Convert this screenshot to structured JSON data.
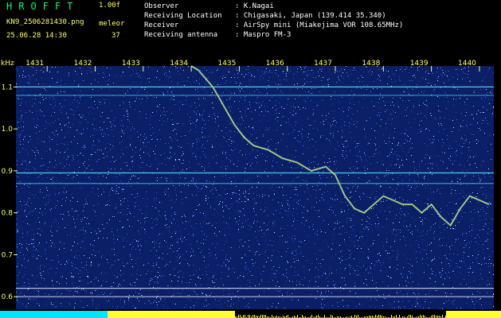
{
  "header": {
    "title": "HROFFT",
    "version": "1.00f",
    "filename": "KN9_2506281430.png",
    "label_right": "meleor",
    "datetime": "25.06.28 14:30",
    "count": "37",
    "info": [
      {
        "key": "Observer",
        "value": ": K.Nagai"
      },
      {
        "key": "Receiving Location",
        "value": ": Chigasaki, Japan (139.414 35.340)"
      },
      {
        "key": "Receiver",
        "value": ": AirSpy mini (Miakejima VOR 108.65MHz)"
      },
      {
        "key": "Receiving antenna",
        "value": ": Maspro FM-3"
      }
    ]
  },
  "chart_data": {
    "type": "heatmap",
    "ylabel": "kHz",
    "y_ticks": [
      "1.1",
      "1.0",
      "0.9",
      "0.8",
      "0.7",
      "0.6"
    ],
    "y_tick_values": [
      1.1,
      1.0,
      0.9,
      0.8,
      0.7,
      0.6
    ],
    "ylim": [
      0.57,
      1.15
    ],
    "x_ticks": [
      "1431",
      "1432",
      "1433",
      "1434",
      "1435",
      "1436",
      "1437",
      "1438",
      "1439",
      "1440"
    ],
    "xlim": [
      1430.35,
      1440.3
    ],
    "horizontal_lines_khz": [
      {
        "y": 1.1,
        "color": "#55ddee"
      },
      {
        "y": 1.08,
        "color": "#33aacc"
      },
      {
        "y": 0.895,
        "color": "#55ddee"
      },
      {
        "y": 0.87,
        "color": "#33aacc"
      },
      {
        "y": 0.62,
        "color": "#ccccee"
      },
      {
        "y": 0.6,
        "color": "#ccccee"
      }
    ],
    "trace": {
      "color": "#ffcc44",
      "x": [
        1434.0,
        1434.15,
        1434.3,
        1434.45,
        1434.6,
        1434.75,
        1434.9,
        1435.1,
        1435.3,
        1435.6,
        1435.9,
        1436.2,
        1436.5,
        1436.8,
        1437.0,
        1437.2,
        1437.4,
        1437.6,
        1437.8,
        1438.0,
        1438.2,
        1438.4,
        1438.6,
        1438.8,
        1439.0,
        1439.2,
        1439.4,
        1439.6,
        1439.8,
        1440.0,
        1440.2
      ],
      "y": [
        1.15,
        1.14,
        1.12,
        1.1,
        1.07,
        1.04,
        1.01,
        0.98,
        0.96,
        0.95,
        0.93,
        0.92,
        0.9,
        0.91,
        0.89,
        0.84,
        0.81,
        0.8,
        0.82,
        0.84,
        0.83,
        0.82,
        0.82,
        0.8,
        0.82,
        0.79,
        0.77,
        0.81,
        0.84,
        0.83,
        0.82
      ]
    },
    "grid": false,
    "legend": "none"
  },
  "colors": {
    "background_noise": "#0a1f66",
    "header_text_green": "#00ff66",
    "header_text_yellow": "#ffff66",
    "axis_text": "#ffff66",
    "bottom_bar_cyan": "#00e5ff",
    "bottom_bar_yellow": "#ffff33"
  }
}
